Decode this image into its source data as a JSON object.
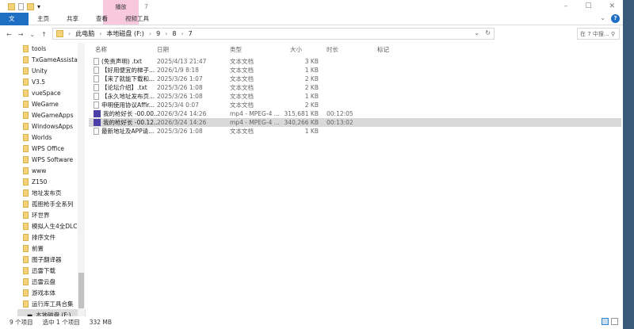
{
  "window": {
    "title": "7",
    "context_tab": "播放",
    "minimize": "–",
    "maximize": "☐",
    "close": "✕"
  },
  "ribbon": {
    "tabs": [
      "文件",
      "主页",
      "共享",
      "查看",
      "视频工具"
    ],
    "help": "?",
    "expand": "⌄"
  },
  "address": {
    "back": "←",
    "forward": "→",
    "recent": "⌄",
    "up": "↑",
    "crumbs": [
      "此电脑",
      "本地磁盘 (F:)",
      "9",
      "8",
      "7"
    ],
    "separator": "›",
    "dropdown": "⌄",
    "refresh": "↻",
    "search_placeholder": "在 7 中搜...",
    "search_icon": "⚲"
  },
  "nav": {
    "items": [
      "tools",
      "TxGameAssistant",
      "Unity",
      "V3.5",
      "vueSpace",
      "WeGame",
      "WeGameApps",
      "WindowsApps",
      "Worlds",
      "WPS Office",
      "WPS Software",
      "www",
      "Z150",
      "地址发布页",
      "孤胆枪手全系列",
      "环世界",
      "模拟人生4全DLC整",
      "排序文件",
      "前置",
      "图子翻译器",
      "迅雷下载",
      "迅雷云盘",
      "游戏本体",
      "运行库工具合集"
    ],
    "drive": "本地磁盘 (F:)"
  },
  "columns": [
    "名称",
    "日期",
    "类型",
    "大小",
    "时长",
    "标记"
  ],
  "files": [
    {
      "name": "(免责声明) .txt",
      "date": "2025/4/13 21:47",
      "type": "文本文档",
      "size": "3 KB",
      "duration": "",
      "icon": "text"
    },
    {
      "name": "【好用便宜的梯子...",
      "date": "2026/1/9 8:18",
      "type": "文本文档",
      "size": "1 KB",
      "duration": "",
      "icon": "text"
    },
    {
      "name": "【来了就能下载和...",
      "date": "2025/3/26 1:07",
      "type": "文本文档",
      "size": "2 KB",
      "duration": "",
      "icon": "text"
    },
    {
      "name": "【论坛介绍】.txt",
      "date": "2025/3/26 1:08",
      "type": "文本文档",
      "size": "2 KB",
      "duration": "",
      "icon": "text"
    },
    {
      "name": "【永久地址发布页...",
      "date": "2025/3/26 1:08",
      "type": "文本文档",
      "size": "1 KB",
      "duration": "",
      "icon": "text"
    },
    {
      "name": "申明使用协议Affir...",
      "date": "2025/3/4 0:07",
      "type": "文本文档",
      "size": "2 KB",
      "duration": "",
      "icon": "text"
    },
    {
      "name": "我的枪好长 -00.00....",
      "date": "2026/3/24 14:26",
      "type": "mp4 - MPEG-4 ...",
      "size": "315,681 KB",
      "duration": "00:12:05",
      "icon": "video"
    },
    {
      "name": "我的枪好长 -00.12....",
      "date": "2026/3/24 14:26",
      "type": "mp4 - MPEG-4 ...",
      "size": "340,266 KB",
      "duration": "00:13:02",
      "icon": "video",
      "selected": true
    },
    {
      "name": "最新地址及APP请...",
      "date": "2025/3/26 1:08",
      "type": "文本文档",
      "size": "1 KB",
      "duration": "",
      "icon": "text"
    }
  ],
  "status": {
    "count": "9 个项目",
    "selected": "选中 1 个项目",
    "size": "332 MB"
  },
  "colors": {
    "accent": "#1e6fc4",
    "context_tab": "#f8c8dc",
    "selection": "#d9d9d9"
  }
}
